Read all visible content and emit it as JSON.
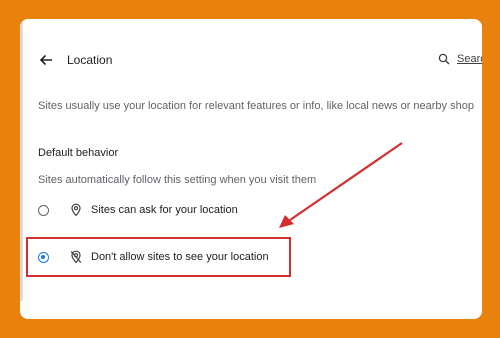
{
  "header": {
    "title": "Location",
    "search_label": "Searc",
    "icons": {
      "back": "arrow-back-icon",
      "search": "search-icon"
    }
  },
  "description": "Sites usually use your location for relevant features or info, like local news or nearby shop",
  "default_behavior": {
    "title": "Default behavior",
    "description": "Sites automatically follow this setting when you visit them",
    "options": [
      {
        "label": "Sites can ask for your location",
        "icon": "location-pin-icon",
        "selected": false
      },
      {
        "label": "Don't allow sites to see your location",
        "icon": "location-off-icon",
        "selected": true
      }
    ]
  },
  "colors": {
    "frame": "#e8820c",
    "accent": "#1a73e8",
    "annotation": "#d32f2f"
  }
}
